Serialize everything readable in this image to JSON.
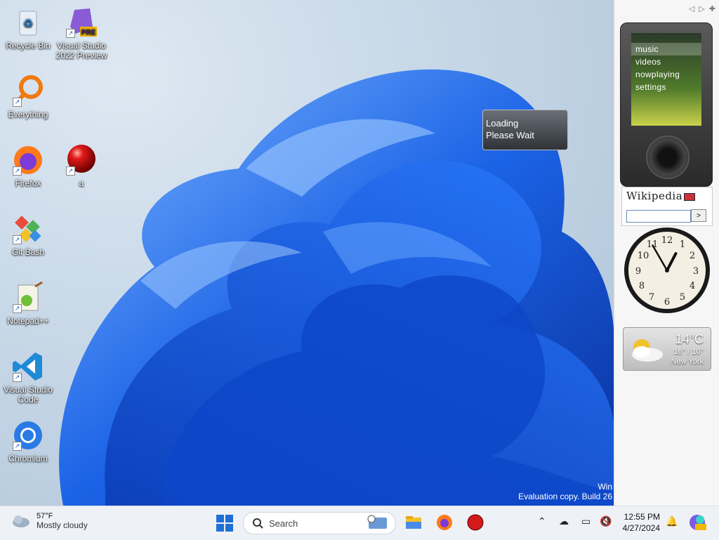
{
  "desktop": {
    "icons": [
      {
        "label": "Recycle Bin",
        "icon": "recycle-bin-icon"
      },
      {
        "label": "Visual Studio 2022 Preview",
        "icon": "visual-studio-icon",
        "badge": "PRE"
      },
      {
        "label": "Everything",
        "icon": "everything-search-icon"
      },
      {
        "label": "Firefox",
        "icon": "firefox-icon"
      },
      {
        "label": "a",
        "icon": "red-ball-icon"
      },
      {
        "label": "Git Bash",
        "icon": "git-bash-icon"
      },
      {
        "label": "Notepad++",
        "icon": "notepad-plus-plus-icon"
      },
      {
        "label": "Visual Studio Code",
        "icon": "vscode-icon"
      },
      {
        "label": "Chromium",
        "icon": "chromium-icon"
      }
    ],
    "watermark_line1": "Win",
    "watermark_line2": "Evaluation copy. Build 26"
  },
  "loading_popup": {
    "line1": "Loading",
    "line2": "Please Wait"
  },
  "sidebar": {
    "zune": {
      "menu": [
        "music",
        "videos",
        "nowplaying",
        "settings"
      ],
      "selected": "music"
    },
    "wikipedia": {
      "logo": "Wikipedia",
      "go_label": ">",
      "search_value": ""
    },
    "clock": {
      "numbers": [
        "12",
        "1",
        "2",
        "3",
        "4",
        "5",
        "6",
        "7",
        "8",
        "9",
        "10",
        "11"
      ],
      "time": "12:55"
    },
    "weather": {
      "temp": "14°C",
      "range": "16° / 10°",
      "city": "New York"
    }
  },
  "taskbar": {
    "weather_temp": "57°F",
    "weather_desc": "Mostly cloudy",
    "search_placeholder": "Search",
    "time": "12:55 PM",
    "date": "4/27/2024",
    "colors": {
      "accent": "#1f6fd6",
      "taskbar_bg": "#eef2f7"
    }
  }
}
